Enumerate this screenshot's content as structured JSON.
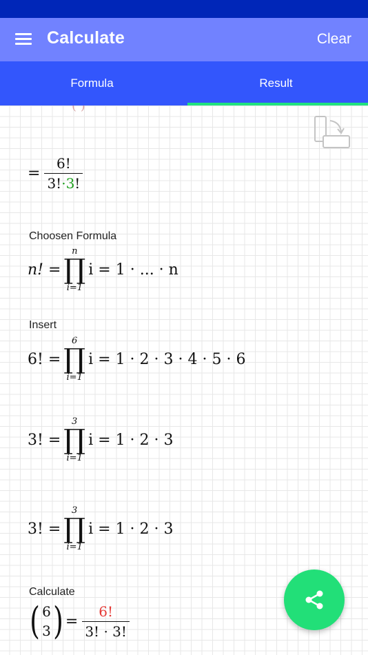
{
  "app": {
    "title": "Calculate",
    "clear_label": "Clear",
    "colors": {
      "statusbar": "#0026b8",
      "appbar": "#7182ff",
      "tabbar": "#3356fc",
      "accent": "#21e27f",
      "fab": "#22df78"
    }
  },
  "tabs": [
    {
      "label": "Formula",
      "selected": false
    },
    {
      "label": "Result",
      "selected": true
    }
  ],
  "content": {
    "top_fraction": {
      "prefix": "=",
      "numerator": "6!",
      "den_left": "3!",
      "den_dot": "·",
      "den_right_digit": "3",
      "den_right_bang": "!"
    },
    "chosen_formula_label": "Choosen Formula",
    "chosen_formula": {
      "lhs": "n! =",
      "upper": "n",
      "lower": "i=1",
      "rhs": "i = 1 · ... · n"
    },
    "insert_label": "Insert",
    "insert_rows": [
      {
        "lhs": "6! =",
        "upper": "6",
        "lower": "i=1",
        "rhs": "i = 1 · 2 · 3 · 4 · 5 · 6"
      },
      {
        "lhs": "3! =",
        "upper": "3",
        "lower": "i=1",
        "rhs": "i = 1 · 2 · 3"
      },
      {
        "lhs": "3! =",
        "upper": "3",
        "lower": "i=1",
        "rhs": "i = 1 · 2 · 3"
      }
    ],
    "calculate_label": "Calculate",
    "binomial": {
      "top": "6",
      "bottom": "3",
      "eq": "=",
      "numerator": "6!",
      "denominator": "3! · 3!"
    }
  },
  "icons": {
    "menu": "menu-icon",
    "rotate": "rotate-screen-icon",
    "share": "share-icon"
  }
}
